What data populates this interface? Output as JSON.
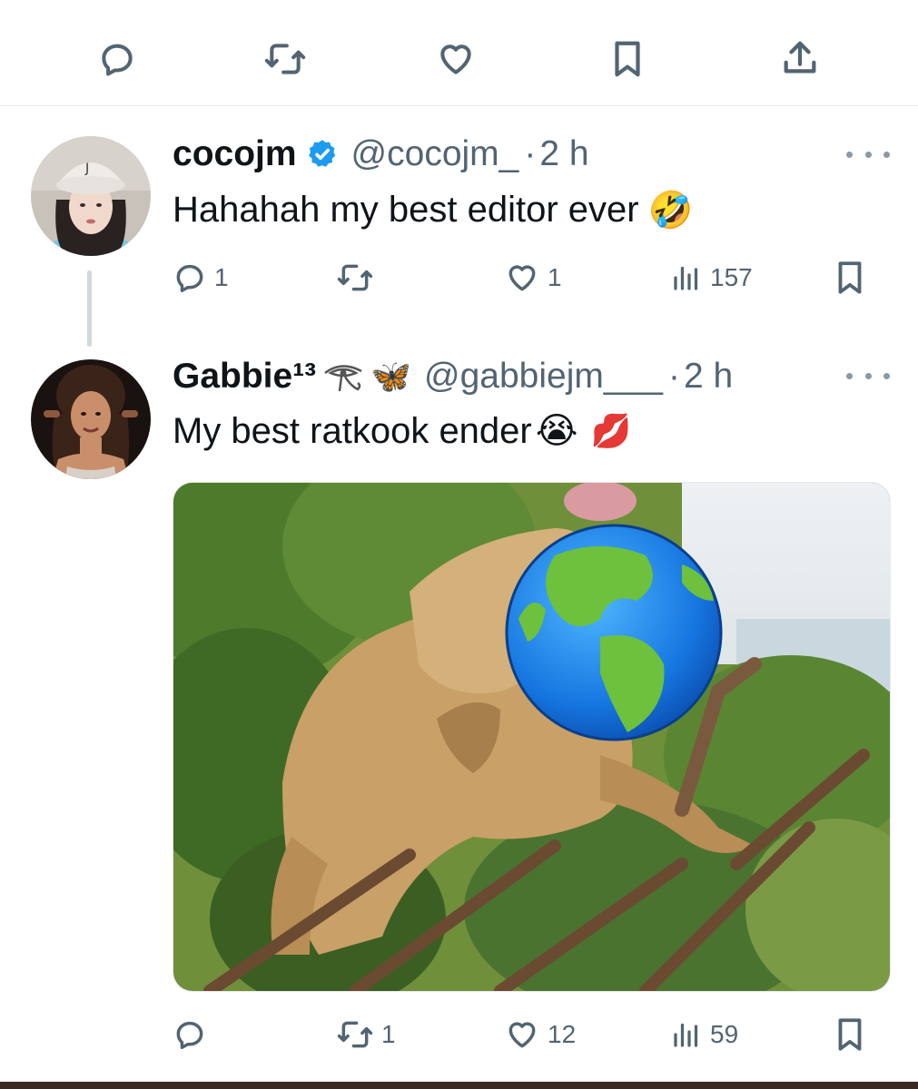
{
  "top_actions": [
    {
      "name": "reply",
      "icon": "reply-icon"
    },
    {
      "name": "retweet",
      "icon": "retweet-icon"
    },
    {
      "name": "like",
      "icon": "heart-icon"
    },
    {
      "name": "bookmark",
      "icon": "bookmark-icon"
    },
    {
      "name": "share",
      "icon": "share-icon"
    }
  ],
  "tweets": [
    {
      "display_name": "cocojm",
      "verified": true,
      "handle": "@cocojm_",
      "separator": "·",
      "time": "2 h",
      "text": "Hahahah my best editor ever",
      "emoji": "🤣",
      "metrics": {
        "replies": "1",
        "retweets": "",
        "likes": "1",
        "views": "157"
      }
    },
    {
      "display_name": "Gabbie¹³",
      "name_emojis": "🦋",
      "handle": "@gabbiejm___",
      "separator": "·",
      "time": "2 h",
      "text": "My best ratkook ender",
      "emoji": "😭",
      "emoji2": "💋",
      "metrics": {
        "replies": "",
        "retweets": "1",
        "likes": "12",
        "views": "59"
      }
    }
  ],
  "colors": {
    "text": "#0f1419",
    "muted": "#536471",
    "verified": "#1d9bf0",
    "divider": "#e6e9ec"
  }
}
